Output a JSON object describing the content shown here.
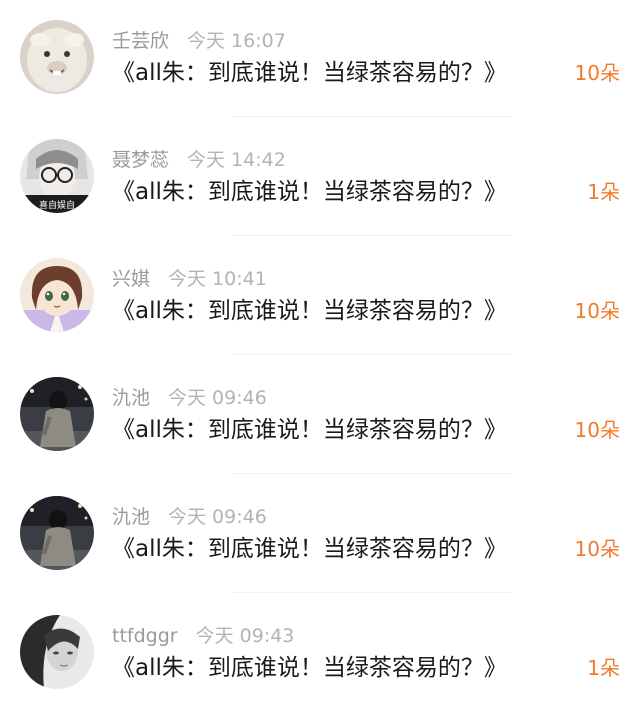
{
  "items": [
    {
      "name": "壬芸欣",
      "time": "今天 16:07",
      "title": "《all朱：到底谁说！当绿茶容易的？》",
      "count": "10朵",
      "avatar_icon": "alpaca-avatar"
    },
    {
      "name": "聂梦蕊",
      "time": "今天 14:42",
      "title": "《all朱：到底谁说！当绿茶容易的？》",
      "count": "1朵",
      "avatar_icon": "glasses-girl-avatar"
    },
    {
      "name": "兴娸",
      "time": "今天 10:41",
      "title": "《all朱：到底谁说！当绿茶容易的？》",
      "count": "10朵",
      "avatar_icon": "anime-girl-avatar"
    },
    {
      "name": "氿池",
      "time": "今天 09:46",
      "title": "《all朱：到底谁说！当绿茶容易的？》",
      "count": "10朵",
      "avatar_icon": "night-street-girl-avatar"
    },
    {
      "name": "氿池",
      "time": "今天 09:46",
      "title": "《all朱：到底谁说！当绿茶容易的？》",
      "count": "10朵",
      "avatar_icon": "night-street-girl-avatar"
    },
    {
      "name": "ttfdggr",
      "time": "今天 09:43",
      "title": "《all朱：到底谁说！当绿茶容易的？》",
      "count": "1朵",
      "avatar_icon": "monochrome-girl-avatar"
    }
  ],
  "colors": {
    "count": "#f07b2b",
    "meta": "#9a9a9a",
    "title": "#1a1a1a"
  }
}
